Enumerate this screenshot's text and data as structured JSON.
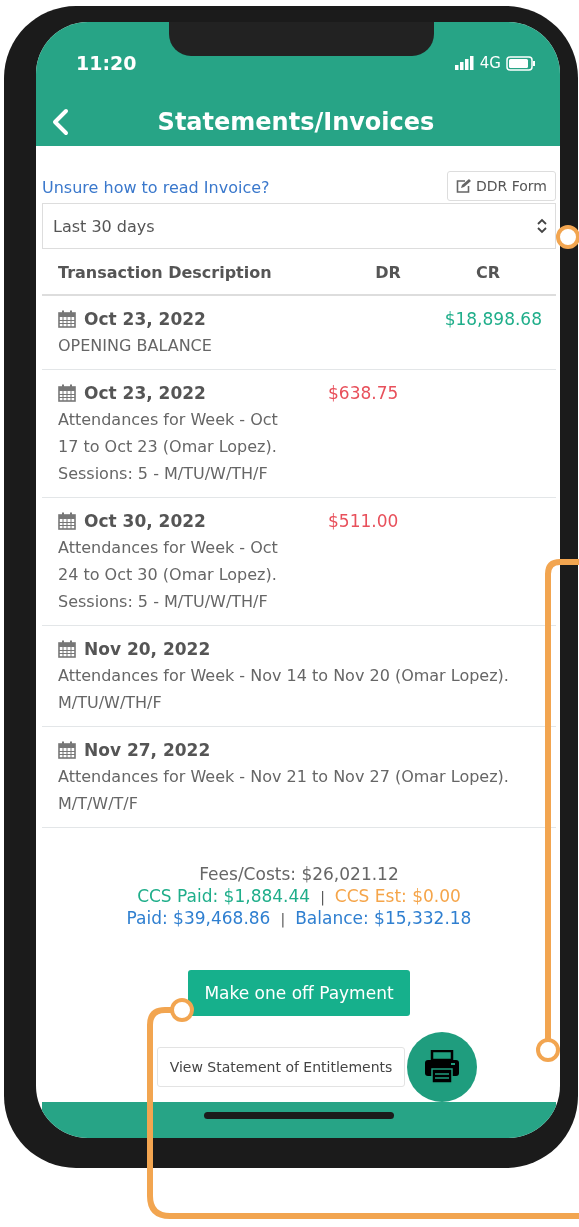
{
  "status_bar": {
    "time": "11:20",
    "network": "4G"
  },
  "header": {
    "title": "Statements/Invoices"
  },
  "help_link": "Unsure how to read Invoice?",
  "ddr_button": "DDR Form",
  "period_select": {
    "value": "Last 30 days"
  },
  "table": {
    "columns": [
      "Transaction Description",
      "DR",
      "CR"
    ],
    "rows": [
      {
        "date": "Oct 23, 2022",
        "lines": [
          "OPENING BALANCE"
        ],
        "cr": "$18,898.68"
      },
      {
        "date": "Oct 23, 2022",
        "lines": [
          "Attendances for Week - Oct",
          "17 to Oct 23 (Omar Lopez).",
          "Sessions: 5 - M/TU/W/TH/F"
        ],
        "dr": "$638.75"
      },
      {
        "date": "Oct 30, 2022",
        "lines": [
          "Attendances for Week - Oct",
          "24 to Oct 30 (Omar Lopez).",
          "Sessions: 5 - M/TU/W/TH/F"
        ],
        "dr": "$511.00"
      },
      {
        "date": "Nov 20, 2022",
        "lines": [
          "Attendances for Week - Nov 14 to Nov 20 (Omar Lopez).",
          "M/TU/W/TH/F"
        ]
      },
      {
        "date": "Nov 27, 2022",
        "lines": [
          "Attendances for Week - Nov 21 to Nov 27 (Omar Lopez).",
          "M/T/W/T/F"
        ]
      }
    ]
  },
  "summary": [
    {
      "parts": [
        {
          "text": "Fees/Costs: $26,021.12",
          "color": "#666666"
        }
      ]
    },
    {
      "parts": [
        {
          "text": "CCS Paid: $1,884.44",
          "color": "#1fae8a"
        },
        {
          "text": "|",
          "kind": "separator"
        },
        {
          "text": "CCS Est: $0.00",
          "color": "#f5a54a"
        }
      ]
    },
    {
      "parts": [
        {
          "text": "Paid: $39,468.86",
          "color": "#2f7fd0"
        },
        {
          "text": "|",
          "kind": "separator"
        },
        {
          "text": "Balance: $15,332.18",
          "color": "#2f7fd0"
        }
      ]
    }
  ],
  "payment_button": "Make one off Payment",
  "entitlements_button": "View Statement of Entitlements"
}
